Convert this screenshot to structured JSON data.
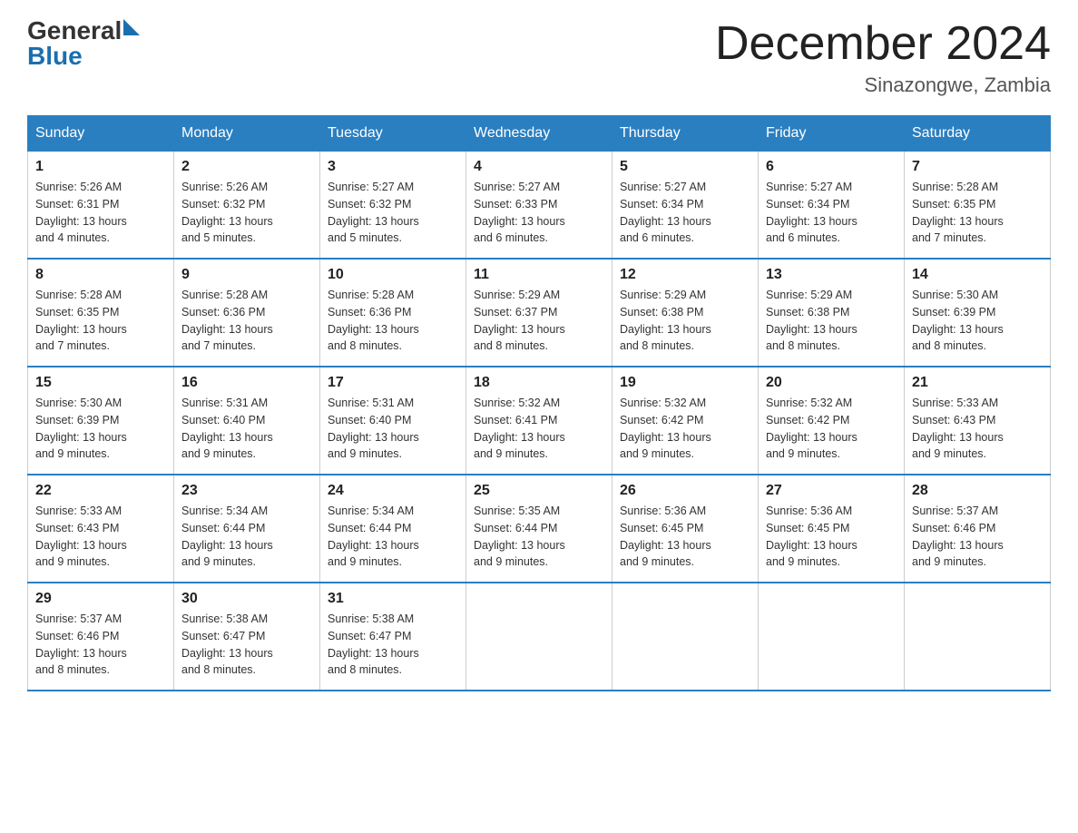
{
  "header": {
    "logo_general": "General",
    "logo_blue": "Blue",
    "title": "December 2024",
    "location": "Sinazongwe, Zambia"
  },
  "days_of_week": [
    "Sunday",
    "Monday",
    "Tuesday",
    "Wednesday",
    "Thursday",
    "Friday",
    "Saturday"
  ],
  "weeks": [
    [
      {
        "day": "1",
        "info": "Sunrise: 5:26 AM\nSunset: 6:31 PM\nDaylight: 13 hours\nand 4 minutes."
      },
      {
        "day": "2",
        "info": "Sunrise: 5:26 AM\nSunset: 6:32 PM\nDaylight: 13 hours\nand 5 minutes."
      },
      {
        "day": "3",
        "info": "Sunrise: 5:27 AM\nSunset: 6:32 PM\nDaylight: 13 hours\nand 5 minutes."
      },
      {
        "day": "4",
        "info": "Sunrise: 5:27 AM\nSunset: 6:33 PM\nDaylight: 13 hours\nand 6 minutes."
      },
      {
        "day": "5",
        "info": "Sunrise: 5:27 AM\nSunset: 6:34 PM\nDaylight: 13 hours\nand 6 minutes."
      },
      {
        "day": "6",
        "info": "Sunrise: 5:27 AM\nSunset: 6:34 PM\nDaylight: 13 hours\nand 6 minutes."
      },
      {
        "day": "7",
        "info": "Sunrise: 5:28 AM\nSunset: 6:35 PM\nDaylight: 13 hours\nand 7 minutes."
      }
    ],
    [
      {
        "day": "8",
        "info": "Sunrise: 5:28 AM\nSunset: 6:35 PM\nDaylight: 13 hours\nand 7 minutes."
      },
      {
        "day": "9",
        "info": "Sunrise: 5:28 AM\nSunset: 6:36 PM\nDaylight: 13 hours\nand 7 minutes."
      },
      {
        "day": "10",
        "info": "Sunrise: 5:28 AM\nSunset: 6:36 PM\nDaylight: 13 hours\nand 8 minutes."
      },
      {
        "day": "11",
        "info": "Sunrise: 5:29 AM\nSunset: 6:37 PM\nDaylight: 13 hours\nand 8 minutes."
      },
      {
        "day": "12",
        "info": "Sunrise: 5:29 AM\nSunset: 6:38 PM\nDaylight: 13 hours\nand 8 minutes."
      },
      {
        "day": "13",
        "info": "Sunrise: 5:29 AM\nSunset: 6:38 PM\nDaylight: 13 hours\nand 8 minutes."
      },
      {
        "day": "14",
        "info": "Sunrise: 5:30 AM\nSunset: 6:39 PM\nDaylight: 13 hours\nand 8 minutes."
      }
    ],
    [
      {
        "day": "15",
        "info": "Sunrise: 5:30 AM\nSunset: 6:39 PM\nDaylight: 13 hours\nand 9 minutes."
      },
      {
        "day": "16",
        "info": "Sunrise: 5:31 AM\nSunset: 6:40 PM\nDaylight: 13 hours\nand 9 minutes."
      },
      {
        "day": "17",
        "info": "Sunrise: 5:31 AM\nSunset: 6:40 PM\nDaylight: 13 hours\nand 9 minutes."
      },
      {
        "day": "18",
        "info": "Sunrise: 5:32 AM\nSunset: 6:41 PM\nDaylight: 13 hours\nand 9 minutes."
      },
      {
        "day": "19",
        "info": "Sunrise: 5:32 AM\nSunset: 6:42 PM\nDaylight: 13 hours\nand 9 minutes."
      },
      {
        "day": "20",
        "info": "Sunrise: 5:32 AM\nSunset: 6:42 PM\nDaylight: 13 hours\nand 9 minutes."
      },
      {
        "day": "21",
        "info": "Sunrise: 5:33 AM\nSunset: 6:43 PM\nDaylight: 13 hours\nand 9 minutes."
      }
    ],
    [
      {
        "day": "22",
        "info": "Sunrise: 5:33 AM\nSunset: 6:43 PM\nDaylight: 13 hours\nand 9 minutes."
      },
      {
        "day": "23",
        "info": "Sunrise: 5:34 AM\nSunset: 6:44 PM\nDaylight: 13 hours\nand 9 minutes."
      },
      {
        "day": "24",
        "info": "Sunrise: 5:34 AM\nSunset: 6:44 PM\nDaylight: 13 hours\nand 9 minutes."
      },
      {
        "day": "25",
        "info": "Sunrise: 5:35 AM\nSunset: 6:44 PM\nDaylight: 13 hours\nand 9 minutes."
      },
      {
        "day": "26",
        "info": "Sunrise: 5:36 AM\nSunset: 6:45 PM\nDaylight: 13 hours\nand 9 minutes."
      },
      {
        "day": "27",
        "info": "Sunrise: 5:36 AM\nSunset: 6:45 PM\nDaylight: 13 hours\nand 9 minutes."
      },
      {
        "day": "28",
        "info": "Sunrise: 5:37 AM\nSunset: 6:46 PM\nDaylight: 13 hours\nand 9 minutes."
      }
    ],
    [
      {
        "day": "29",
        "info": "Sunrise: 5:37 AM\nSunset: 6:46 PM\nDaylight: 13 hours\nand 8 minutes."
      },
      {
        "day": "30",
        "info": "Sunrise: 5:38 AM\nSunset: 6:47 PM\nDaylight: 13 hours\nand 8 minutes."
      },
      {
        "day": "31",
        "info": "Sunrise: 5:38 AM\nSunset: 6:47 PM\nDaylight: 13 hours\nand 8 minutes."
      },
      {
        "day": "",
        "info": ""
      },
      {
        "day": "",
        "info": ""
      },
      {
        "day": "",
        "info": ""
      },
      {
        "day": "",
        "info": ""
      }
    ]
  ]
}
